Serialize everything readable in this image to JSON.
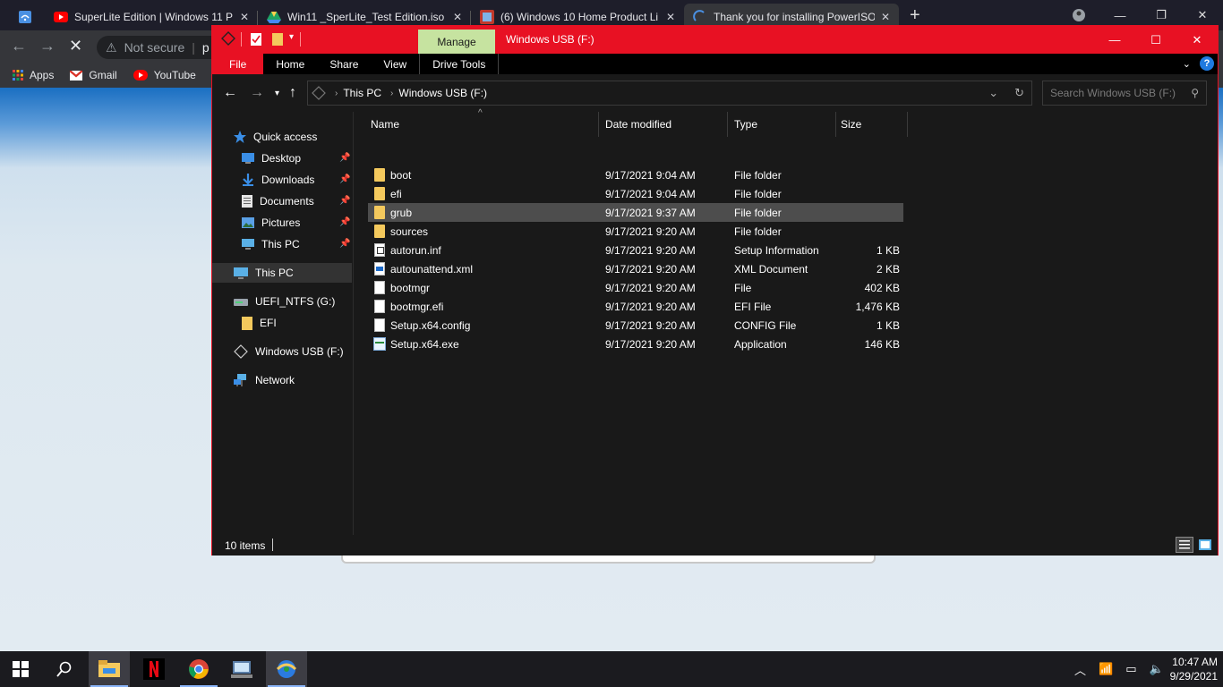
{
  "browser": {
    "tabs": [
      {
        "title": "SuperLite Edition | Windows 11 P",
        "icon_color": "#ff0000"
      },
      {
        "title": "Win11 _SperLite_Test Edition.iso",
        "icon_color": "#1fa463"
      },
      {
        "title": "(6) Windows 10 Home Product Li",
        "icon_color": "#b03030"
      },
      {
        "title": "Thank you for installing PowerISO",
        "icon_color": "#4a90e2"
      }
    ],
    "address_security": "Not secure",
    "address_partial": "p",
    "bookmarks": [
      {
        "label": "Apps",
        "icon": "apps-grid-icon"
      },
      {
        "label": "Gmail",
        "icon": "gmail-icon"
      },
      {
        "label": "YouTube",
        "icon": "youtube-icon"
      }
    ]
  },
  "explorer": {
    "title": "Windows USB (F:)",
    "contextual_tab": "Manage",
    "ribbon_tabs": [
      "File",
      "Home",
      "Share",
      "View",
      "Drive Tools"
    ],
    "breadcrumb": [
      "This PC",
      "Windows USB (F:)"
    ],
    "search_placeholder": "Search Windows USB (F:)",
    "accent": "#e81123",
    "nav": {
      "quick_access": "Quick access",
      "pinned": [
        "Desktop",
        "Downloads",
        "Documents",
        "Pictures",
        "This PC"
      ],
      "this_pc": "This PC",
      "uefi_drive": "UEFI_NTFS (G:)",
      "uefi_child": "EFI",
      "usb_drive": "Windows USB (F:)",
      "network": "Network"
    },
    "columns": {
      "name": "Name",
      "date": "Date modified",
      "type": "Type",
      "size": "Size"
    },
    "files": [
      {
        "name": "boot",
        "date": "9/17/2021 9:04 AM",
        "type": "File folder",
        "size": "",
        "icon": "folder-icon"
      },
      {
        "name": "efi",
        "date": "9/17/2021 9:04 AM",
        "type": "File folder",
        "size": "",
        "icon": "folder-icon"
      },
      {
        "name": "grub",
        "date": "9/17/2021 9:37 AM",
        "type": "File folder",
        "size": "",
        "icon": "folder-icon"
      },
      {
        "name": "sources",
        "date": "9/17/2021 9:20 AM",
        "type": "File folder",
        "size": "",
        "icon": "folder-icon"
      },
      {
        "name": "autorun.inf",
        "date": "9/17/2021 9:20 AM",
        "type": "Setup Information",
        "size": "1 KB",
        "icon": "inf-file-icon"
      },
      {
        "name": "autounattend.xml",
        "date": "9/17/2021 9:20 AM",
        "type": "XML Document",
        "size": "2 KB",
        "icon": "xml-file-icon"
      },
      {
        "name": "bootmgr",
        "date": "9/17/2021 9:20 AM",
        "type": "File",
        "size": "402 KB",
        "icon": "file-icon"
      },
      {
        "name": "bootmgr.efi",
        "date": "9/17/2021 9:20 AM",
        "type": "EFI File",
        "size": "1,476 KB",
        "icon": "file-icon"
      },
      {
        "name": "Setup.x64.config",
        "date": "9/17/2021 9:20 AM",
        "type": "CONFIG File",
        "size": "1 KB",
        "icon": "file-icon"
      },
      {
        "name": "Setup.x64.exe",
        "date": "9/17/2021 9:20 AM",
        "type": "Application",
        "size": "146 KB",
        "icon": "exe-icon"
      }
    ],
    "selected_file": "grub",
    "status_count": "10 items"
  },
  "taskbar": {
    "time": "10:47 AM",
    "date": "9/29/2021"
  }
}
